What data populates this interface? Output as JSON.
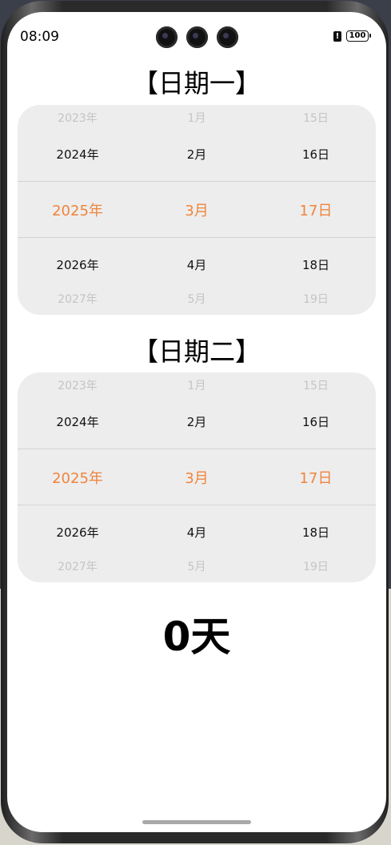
{
  "status_bar": {
    "time": "08:09",
    "battery": "100"
  },
  "picker1": {
    "title": "【日期一】",
    "years": [
      "2023年",
      "2024年",
      "2025年",
      "2026年",
      "2027年"
    ],
    "months": [
      "1月",
      "2月",
      "3月",
      "4月",
      "5月"
    ],
    "days": [
      "15日",
      "16日",
      "17日",
      "18日",
      "19日"
    ]
  },
  "picker2": {
    "title": "【日期二】",
    "years": [
      "2023年",
      "2024年",
      "2025年",
      "2026年",
      "2027年"
    ],
    "months": [
      "1月",
      "2月",
      "3月",
      "4月",
      "5月"
    ],
    "days": [
      "15日",
      "16日",
      "17日",
      "18日",
      "19日"
    ]
  },
  "result": "0天",
  "colors": {
    "selected": "#f0843c",
    "picker_bg": "#ededed"
  }
}
